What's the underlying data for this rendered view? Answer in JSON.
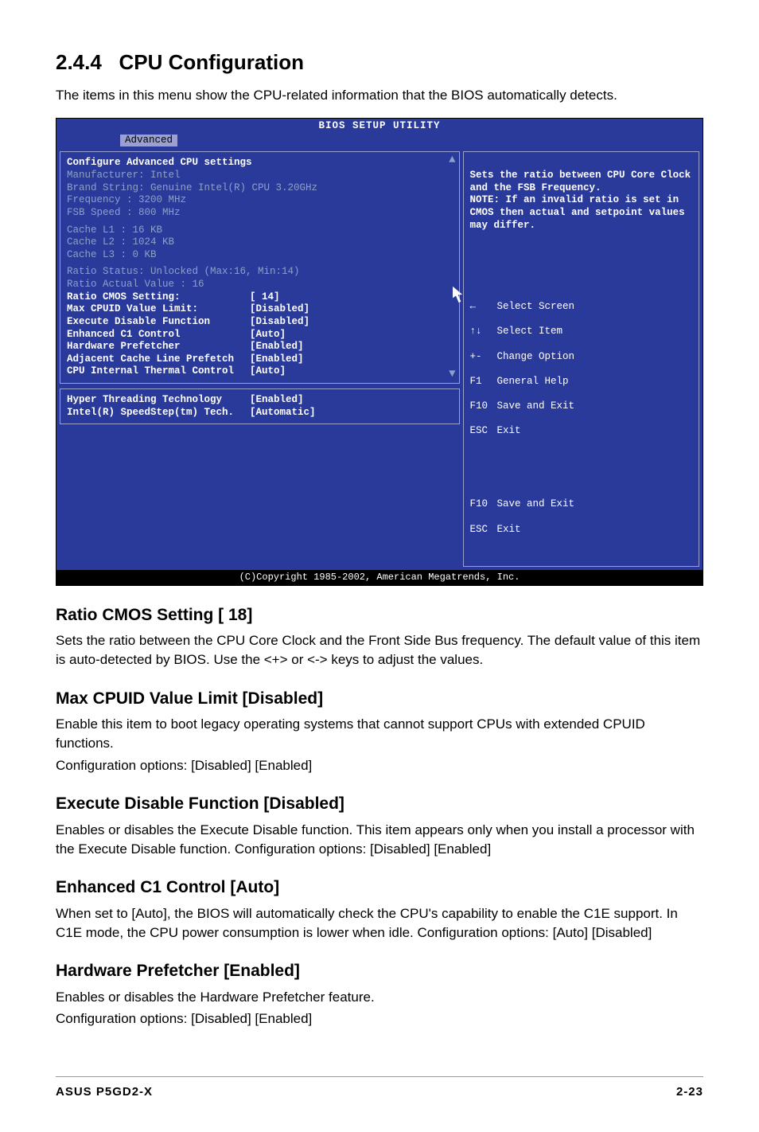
{
  "header": {
    "section_number": "2.4.4",
    "section_title": "CPU Configuration",
    "intro": "The items in this menu show the CPU-related information that the BIOS automatically detects."
  },
  "bios": {
    "title": "BIOS SETUP UTILITY",
    "active_tab": "Advanced",
    "panel1_title": "Configure Advanced CPU settings",
    "info": {
      "manufacturer": "Manufacturer: Intel",
      "brand": "Brand String: Genuine Intel(R) CPU 3.20GHz",
      "frequency": "Frequency   : 3200 MHz",
      "fsb": "FSB Speed   : 800 MHz",
      "l1": "Cache L1    : 16 KB",
      "l2": "Cache L2    : 1024 KB",
      "l3": "Cache L3    : 0 KB",
      "ratio_status": "Ratio Status: Unlocked (Max:16, Min:14)",
      "ratio_actual": "Ratio Actual Value : 16"
    },
    "settings": [
      {
        "label": "  Ratio CMOS Setting:",
        "value": "[ 14]"
      },
      {
        "label": "Max CPUID Value Limit:",
        "value": "[Disabled]"
      },
      {
        "label": "Execute Disable Function",
        "value": "[Disabled]"
      },
      {
        "label": "Enhanced C1 Control",
        "value": "[Auto]"
      },
      {
        "label": "Hardware Prefetcher",
        "value": "[Enabled]"
      },
      {
        "label": "Adjacent Cache Line Prefetch",
        "value": "[Enabled]"
      },
      {
        "label": "CPU Internal Thermal Control",
        "value": "[Auto]"
      }
    ],
    "settings2": [
      {
        "label": "Hyper Threading Technology",
        "value": "[Enabled]"
      },
      {
        "label": "Intel(R) SpeedStep(tm) Tech.",
        "value": "[Automatic]"
      }
    ],
    "help_text": "Sets the ratio between CPU Core Clock and the FSB Frequency.\nNOTE: If an invalid ratio is set in CMOS then actual and setpoint values may differ.",
    "keys": [
      {
        "k": "←",
        "d": "Select Screen"
      },
      {
        "k": "↑↓",
        "d": "Select Item"
      },
      {
        "k": "+-",
        "d": "Change Option"
      },
      {
        "k": "F1",
        "d": "General Help"
      },
      {
        "k": "F10",
        "d": "Save and Exit"
      },
      {
        "k": "ESC",
        "d": "Exit"
      }
    ],
    "keys2": [
      {
        "k": "F10",
        "d": "Save and Exit"
      },
      {
        "k": "ESC",
        "d": "Exit"
      }
    ],
    "copyright": "(C)Copyright 1985-2002, American Megatrends, Inc."
  },
  "sections": [
    {
      "title": "Ratio CMOS Setting [ 18]",
      "paras": [
        "Sets the ratio between the CPU Core Clock and the Front Side Bus frequency. The default value of this item is auto-detected by BIOS. Use the <+> or <-> keys to adjust the values."
      ]
    },
    {
      "title": "Max CPUID Value Limit [Disabled]",
      "paras": [
        "Enable this item to boot legacy operating systems that cannot support CPUs with extended CPUID functions.",
        "Configuration options: [Disabled] [Enabled]"
      ]
    },
    {
      "title": "Execute Disable Function [Disabled]",
      "paras": [
        "Enables or disables the Execute Disable function. This item appears only when you install a processor with the Execute Disable function. Configuration options: [Disabled] [Enabled]"
      ]
    },
    {
      "title": "Enhanced C1 Control [Auto]",
      "paras": [
        "When set to [Auto], the BIOS will automatically check the CPU's capability to enable the C1E support. In C1E mode, the CPU power consumption is lower when idle. Configuration options: [Auto] [Disabled]"
      ]
    },
    {
      "title": "Hardware Prefetcher [Enabled]",
      "paras": [
        "Enables or disables the Hardware Prefetcher feature.",
        "Configuration options: [Disabled] [Enabled]"
      ]
    }
  ],
  "footer": {
    "left": "ASUS P5GD2-X",
    "right": "2-23"
  }
}
